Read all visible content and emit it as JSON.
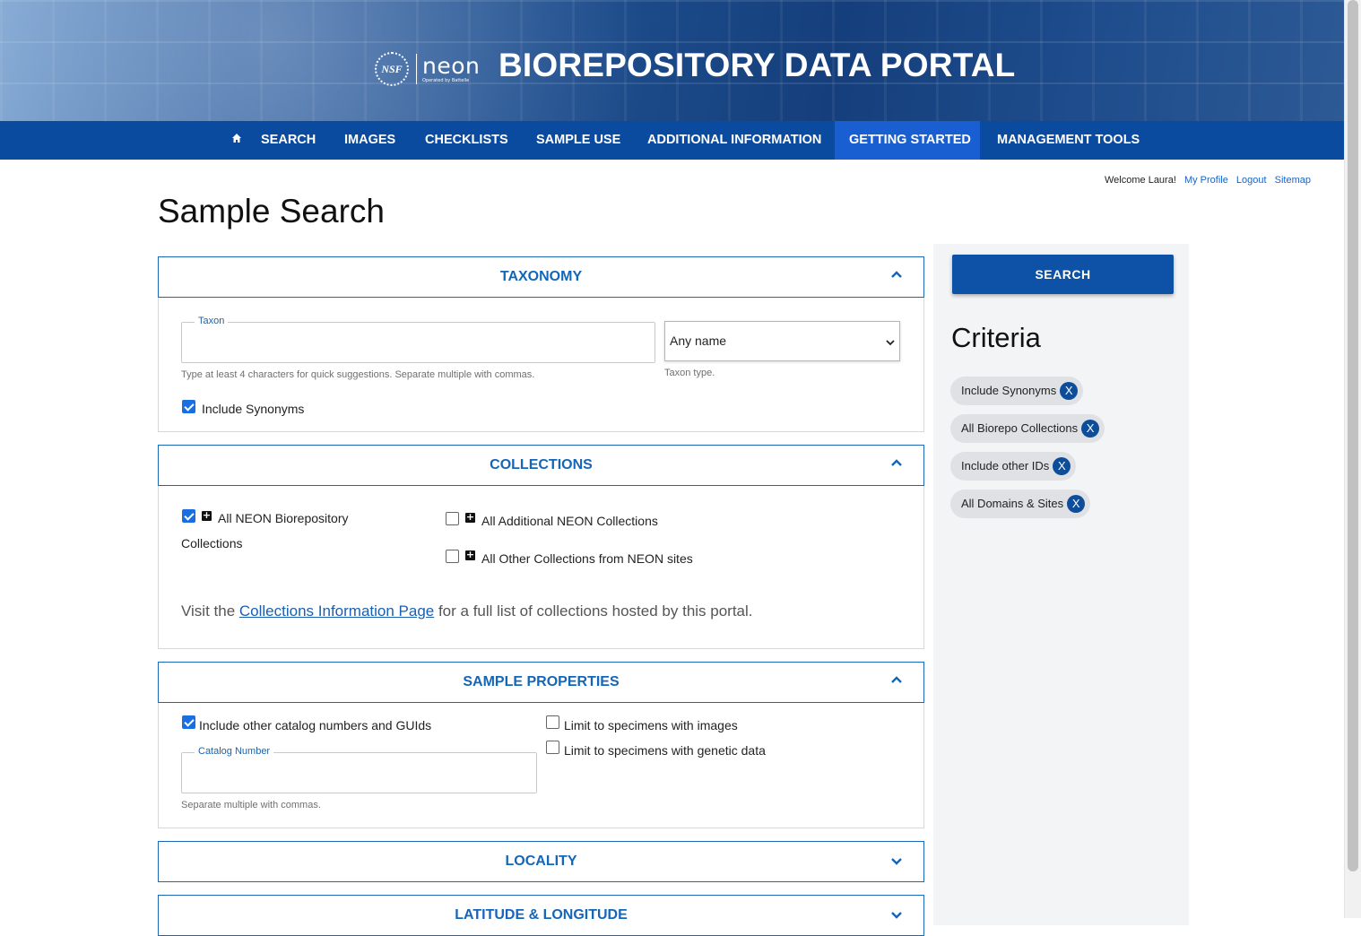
{
  "header": {
    "nsf_logo_text": "NSF",
    "neon_logo_text": "neon",
    "neon_logo_subtext": "Operated by Battelle",
    "site_title": "BIOREPOSITORY DATA PORTAL"
  },
  "nav": {
    "items": [
      {
        "label": "SEARCH"
      },
      {
        "label": "IMAGES"
      },
      {
        "label": "CHECKLISTS"
      },
      {
        "label": "SAMPLE USE"
      },
      {
        "label": "ADDITIONAL INFORMATION"
      },
      {
        "label": "GETTING STARTED",
        "active": true
      },
      {
        "label": "MANAGEMENT TOOLS"
      }
    ],
    "home_icon": "home-icon"
  },
  "user_bar": {
    "welcome": "Welcome Laura!",
    "my_profile": "My Profile",
    "logout": "Logout",
    "sitemap": "Sitemap"
  },
  "page_title": "Sample Search",
  "taxonomy": {
    "title": "TAXONOMY",
    "taxon_legend": "Taxon",
    "taxon_value": "",
    "taxon_help": "Type at least 4 characters for quick suggestions. Separate multiple with commas.",
    "taxon_type_value": "Any name",
    "taxon_type_help": "Taxon type.",
    "include_synonyms_label": "Include Synonyms",
    "include_synonyms_checked": true
  },
  "collections": {
    "title": "COLLECTIONS",
    "all_neon_line1": "All NEON Biorepository",
    "all_neon_line2": "Collections",
    "all_neon_checked": true,
    "additional_label": "All Additional NEON Collections",
    "other_label": "All Other Collections from NEON sites",
    "info_prefix": "Visit the ",
    "info_link": "Collections Information Page",
    "info_suffix": " for a full list of collections hosted by this portal."
  },
  "sample_properties": {
    "title": "SAMPLE PROPERTIES",
    "include_other_label": "Include other catalog numbers and GUIds",
    "include_other_checked": true,
    "catalog_legend": "Catalog Number",
    "catalog_value": "",
    "catalog_help": "Separate multiple with commas.",
    "images_label": "Limit to specimens with images",
    "genetic_label": "Limit to specimens with genetic data"
  },
  "locality": {
    "title": "LOCALITY"
  },
  "latlong": {
    "title": "LATITUDE & LONGITUDE"
  },
  "sidebar": {
    "search_button": "SEARCH",
    "criteria_title": "Criteria",
    "chips": [
      {
        "label": "Include Synonyms"
      },
      {
        "label": "All Biorepo Collections"
      },
      {
        "label": "Include other IDs"
      },
      {
        "label": "All Domains & Sites"
      }
    ],
    "chip_remove": "X"
  },
  "colors": {
    "nav_bg": "#0a4ba0",
    "nav_active": "#1a5fd1",
    "accent_blue": "#1466b8",
    "chip_bg": "#dfe1e4",
    "search_button_bg": "#0d52a6"
  }
}
